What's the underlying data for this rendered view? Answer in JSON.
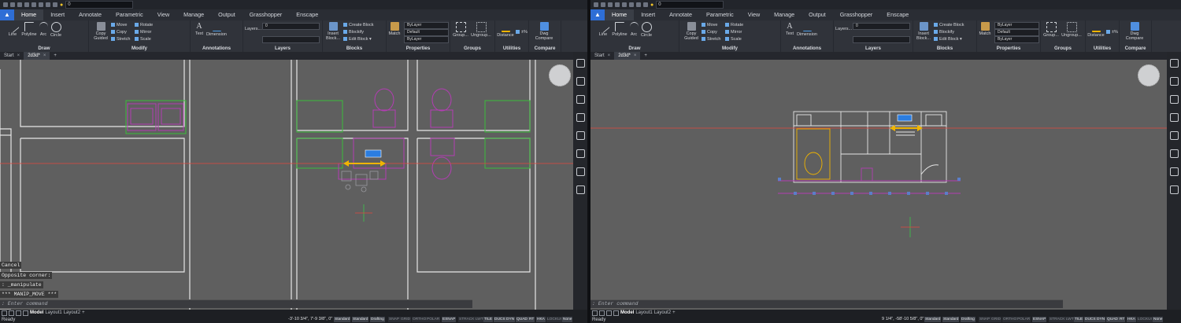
{
  "quick_access": {
    "layer_value": "0"
  },
  "ribbon_tabs": [
    "Home",
    "Insert",
    "Annotate",
    "Parametric",
    "View",
    "Manage",
    "Output",
    "Grasshopper",
    "Enscape"
  ],
  "panels": {
    "draw": {
      "title": "Draw",
      "tools": [
        "Line",
        "Polyline",
        "Arc",
        "Circle"
      ]
    },
    "modify": {
      "title": "Modify",
      "copy_guided": "Copy Guided",
      "items": [
        "Move",
        "Copy",
        "Stretch",
        "Rotate",
        "Mirror",
        "Scale"
      ]
    },
    "annotations": {
      "title": "Annotations",
      "tools": [
        "Text",
        "Dimension"
      ]
    },
    "layers": {
      "title": "Layers",
      "layers_button": "Layers...",
      "layer_value": "0"
    },
    "blocks": {
      "title": "Blocks",
      "insert": "Insert Block...",
      "items": [
        "Create Block",
        "Blockify",
        "Edit Block ▾"
      ]
    },
    "properties": {
      "title": "Properties",
      "match": "Match",
      "color": "ByLayer",
      "linetype": "Default",
      "lineweight": "ByLayer"
    },
    "groups": {
      "title": "Groups",
      "tools": [
        "Group...",
        "Ungroup..."
      ]
    },
    "utilities": {
      "title": "Utilities",
      "distance": "Distance",
      "percent": "±%"
    },
    "compare": {
      "title": "Compare",
      "tool": "Dwg Compare"
    }
  },
  "doc_tabs": [
    "Start",
    "2d3d*"
  ],
  "left": {
    "command_history": [
      "Cancel",
      "Opposite corner:",
      ": _manipulate",
      "*** MANIP_MOVE ***"
    ],
    "command_prompt": ": Enter command",
    "coords": "-3'-10 3/4\", 7'-9 3/8\", 0\""
  },
  "right": {
    "command_prompt": ": Enter command",
    "coords": "9 1/4\", -58'-10 5/8\", 0\""
  },
  "status": {
    "ready": "Ready",
    "layouts": [
      "Model",
      "Layout1",
      "Layout2"
    ],
    "buttons": [
      "Standard",
      "Standard",
      "Drafting",
      "SNAP",
      "GRID",
      "ORTHO",
      "POLAR",
      "ESNAP",
      "STRACK",
      "LWT",
      "TILE",
      "DUCS",
      "DYN",
      "QUAD",
      "RT",
      "HKA",
      "LOCKUI",
      "None"
    ],
    "on_buttons": [
      "Standard",
      "Drafting",
      "ESNAP",
      "TILE",
      "DUCS",
      "DYN",
      "QUAD",
      "RT",
      "HKA",
      "None"
    ]
  },
  "colors": {
    "accent": "#2e6ed6",
    "canvas": "#5f5f5f",
    "crosshair_red": "#e0463c",
    "crosshair_green": "#3cc84a",
    "magenta": "#b33db3",
    "green_lines": "#3bbd3b",
    "yellow_grip": "#f0b400"
  }
}
